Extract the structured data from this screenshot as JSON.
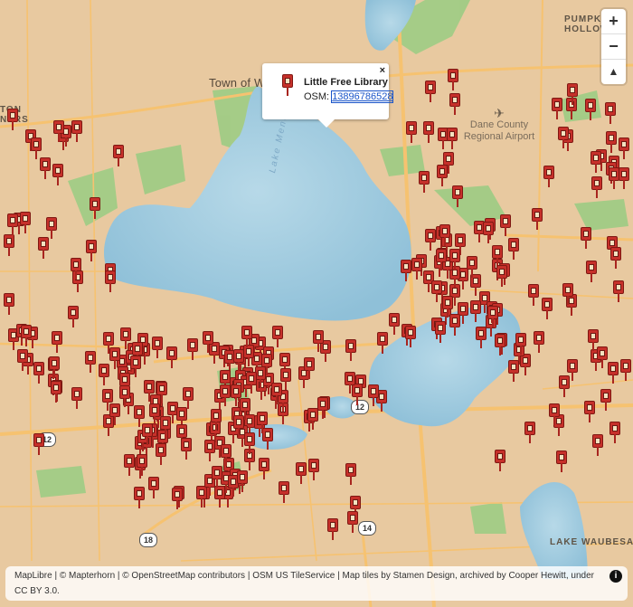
{
  "places": {
    "town_of_westport": "Town of We",
    "dane_county_airport": "Dane County\nRegional Airport",
    "pumpkin_hollow": "PUMPKIN\nHOLLOW",
    "lake_waubesa": "LAKE WAUBESA",
    "lake_mendota": "Lake Mend",
    "left_edge": "TON\nNERS"
  },
  "highway_shields": [
    "12",
    "12",
    "14",
    "18"
  ],
  "zoom_controls": {
    "zoom_in": "+",
    "zoom_out": "−",
    "reset_north": "▲"
  },
  "popup": {
    "title": "Little Free Library",
    "osm_label": "OSM:",
    "osm_id": "13896786528",
    "close": "×"
  },
  "attribution": {
    "text": "MapLibre | © Mapterhorn | © OpenStreetMap contributors | OSM US TileService | Map tiles by Stamen Design, archived by Cooper Hewitt, under CC BY 3.0.",
    "info": "i"
  },
  "colors": {
    "land": "#e8c9a0",
    "water": "#a8cfe0",
    "park": "#9dcc84",
    "road": "#f6c270",
    "pin": "#c6302a"
  },
  "markers": {
    "icon": "little-free-library-icon",
    "count": 290
  }
}
